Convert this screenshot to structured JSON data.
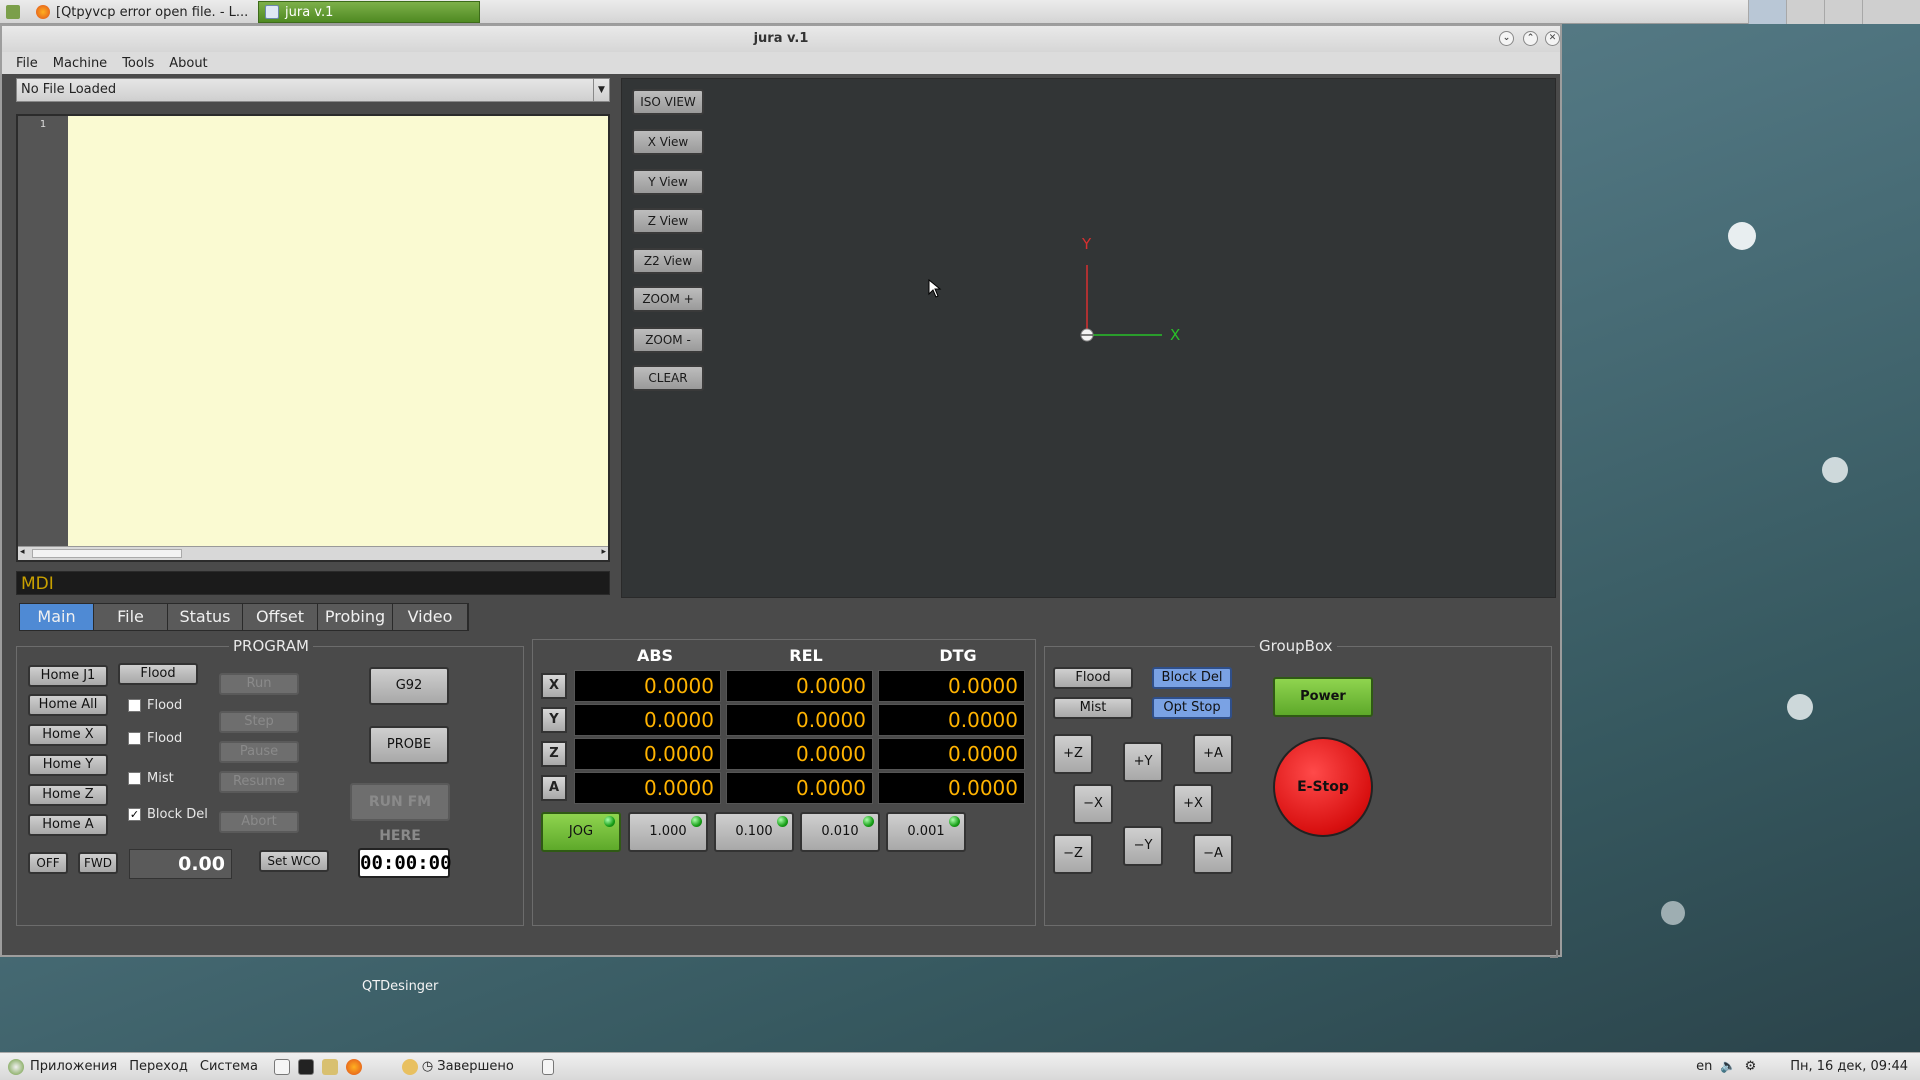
{
  "taskbar": {
    "tasks": [
      "[Qtpyvcp error open file. - L...",
      "jura v.1"
    ]
  },
  "window": {
    "title": "jura v.1"
  },
  "menu": [
    "File",
    "Machine",
    "Tools",
    "About"
  ],
  "file_combo": {
    "value": "No File Loaded"
  },
  "editor": {
    "line_number": "1"
  },
  "mdi": {
    "placeholder": "MDI"
  },
  "view_buttons": [
    "ISO VIEW",
    "X View",
    "Y View",
    "Z View",
    "Z2 View",
    "ZOOM +",
    "ZOOM -",
    "CLEAR"
  ],
  "axes_overlay": {
    "y_label": "Y",
    "x_label": "X"
  },
  "tabs": [
    "Main",
    "File",
    "Status",
    "Offset",
    "Probing",
    "Video"
  ],
  "program_panel": {
    "title": "PROGRAM",
    "home_buttons": [
      "Home J1",
      "Home All",
      "Home X",
      "Home Y",
      "Home Z",
      "Home A"
    ],
    "flood_button": "Flood",
    "checks": [
      {
        "label": "Flood",
        "checked": false
      },
      {
        "label": "Flood",
        "checked": false
      },
      {
        "label": "Mist",
        "checked": false
      },
      {
        "label": "Block Del",
        "checked": true
      }
    ],
    "program_buttons": [
      "Run",
      "Step",
      "Pause",
      "Resume",
      "Abort"
    ],
    "g92": "G92",
    "probe": "PROBE",
    "run_from_here": "RUN FM HERE",
    "off": "OFF",
    "fwd": "FWD",
    "spindle_value": "0.00",
    "set_wco": "Set WCO",
    "timer": "00:00:00"
  },
  "dro_panel": {
    "headers": [
      "ABS",
      "REL",
      "DTG"
    ],
    "rows": [
      {
        "axis": "X",
        "values": [
          "0.0000",
          "0.0000",
          "0.0000"
        ]
      },
      {
        "axis": "Y",
        "values": [
          "0.0000",
          "0.0000",
          "0.0000"
        ]
      },
      {
        "axis": "Z",
        "values": [
          "0.0000",
          "0.0000",
          "0.0000"
        ]
      },
      {
        "axis": "A",
        "values": [
          "0.0000",
          "0.0000",
          "0.0000"
        ]
      }
    ],
    "jog": "JOG",
    "increments": [
      "1.000",
      "0.100",
      "0.010",
      "0.001"
    ]
  },
  "group_panel": {
    "title": "GroupBox",
    "flood": "Flood",
    "block_del": "Block Del",
    "mist": "Mist",
    "opt_stop": "Opt Stop",
    "jog_buttons": [
      "+Z",
      "+Y",
      "+A",
      "−X",
      "+X",
      "−Z",
      "−Y",
      "−A"
    ],
    "power": "Power",
    "estop": "E-Stop"
  },
  "desktop": {
    "icon_label": "QTDesinger"
  },
  "bottom_bar": {
    "apps": "Приложения",
    "places": "Переход",
    "system": "Система",
    "task": "Завершено",
    "lang": "en",
    "clock": "Пн, 16 дек, 09:44"
  },
  "colors": {
    "accent": "#4f8ad4",
    "dro_text": "#ffb300",
    "jog_active": "#7cc43c",
    "estop": "#e01818"
  }
}
